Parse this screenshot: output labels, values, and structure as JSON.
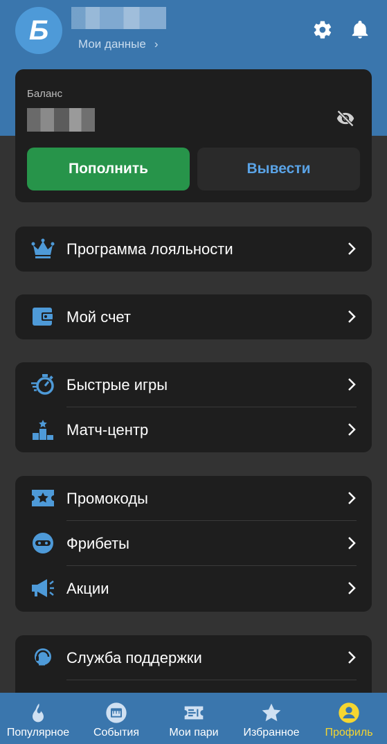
{
  "header": {
    "logo_letter": "Б",
    "my_data_label": "Мои данные",
    "chevron": "›",
    "settings_icon": "gear-icon",
    "notifications_icon": "bell-icon"
  },
  "balance": {
    "label": "Баланс",
    "hide_icon": "eye-off-icon",
    "topup_label": "Пополнить",
    "withdraw_label": "Вывести"
  },
  "menu": {
    "loyalty": {
      "label": "Программа лояльности",
      "icon": "crown-icon"
    },
    "account": {
      "label": "Мой счет",
      "icon": "wallet-icon"
    },
    "fast_games": {
      "label": "Быстрые игры",
      "icon": "stopwatch-icon"
    },
    "match_center": {
      "label": "Матч-центр",
      "icon": "podium-icon"
    },
    "promocodes": {
      "label": "Промокоды",
      "icon": "ticket-star-icon"
    },
    "freebets": {
      "label": "Фрибеты",
      "icon": "freebet-icon"
    },
    "promotions": {
      "label": "Акции",
      "icon": "megaphone-icon"
    },
    "support": {
      "label": "Служба поддержки",
      "icon": "support-icon"
    }
  },
  "nav": {
    "popular": "Популярное",
    "events": "События",
    "my_bets": "Мои пари",
    "favorites": "Избранное",
    "profile": "Профиль"
  },
  "colors": {
    "header": "#3a76ad",
    "accent_green": "#27944a",
    "accent_blue": "#5aa3e6",
    "active_nav": "#f5d630",
    "card_bg": "#1e1e1e",
    "page_bg": "#333333"
  }
}
